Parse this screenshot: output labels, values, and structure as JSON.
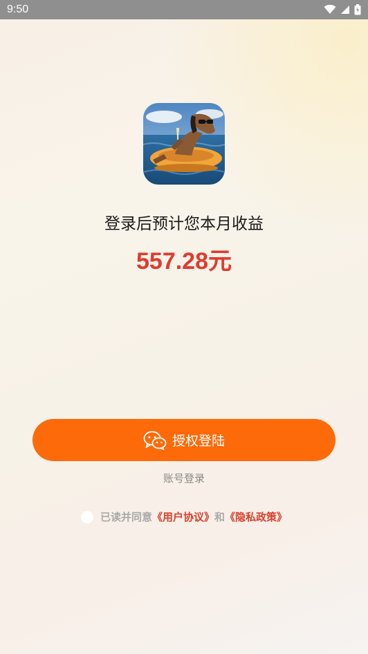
{
  "status_bar": {
    "time": "9:50",
    "icons": [
      "wifi-icon",
      "signal-icon",
      "battery-icon"
    ]
  },
  "app": {
    "logo_icon": "horse-on-inflatable-boat-logo"
  },
  "headline": "登录后预计您本月收益",
  "earnings": "557.28元",
  "auth_button": {
    "icon": "wechat-icon",
    "label": "授权登陆"
  },
  "account_login": "账号登录",
  "agreement": {
    "prefix": "已读并同意",
    "user_agreement": "《用户协议》",
    "conjunction": "和",
    "privacy_policy": "《隐私政策》"
  },
  "colors": {
    "accent": "#fd6a0a",
    "earnings": "#e13a2e",
    "link": "#d9402e"
  }
}
